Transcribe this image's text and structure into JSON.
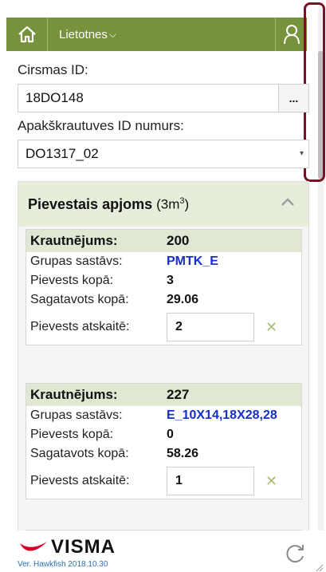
{
  "topbar": {
    "apps_label": "Lietotnes",
    "apps_chevron": "⌵"
  },
  "form": {
    "cirsmas_label": "Cirsmas ID:",
    "cirsmas_value": "18DO148",
    "browse_label": "...",
    "apaks_label": "Apakškrautuves ID numurs:",
    "apaks_value": "DO1317_02"
  },
  "panel": {
    "title": "Pievestais apjoms",
    "unit_prefix": "(3m",
    "unit_sup": "3",
    "unit_suffix": ")"
  },
  "cards": [
    {
      "head_label": "Krautnējums:",
      "head_value": "200",
      "group_label": "Grupas sastāvs:",
      "group_value": "PMTK_E",
      "total_label": "Pievests kopā:",
      "total_value": "3",
      "prepared_label": "Sagatavots kopā:",
      "prepared_value": "29.06",
      "report_label": "Pievests atskaitē:",
      "report_value": "2"
    },
    {
      "head_label": "Krautnējums:",
      "head_value": "227",
      "group_label": "Grupas sastāvs:",
      "group_value": "E_10X14,18X28,28",
      "total_label": "Pievests kopā:",
      "total_value": "0",
      "prepared_label": "Sagatavots kopā:",
      "prepared_value": "58.26",
      "report_label": "Pievests atskaitē:",
      "report_value": "1"
    }
  ],
  "footer": {
    "logo_text": "VISMA",
    "version": "Ver. Hawkfish 2018.10.30"
  },
  "colors": {
    "header_green": "#76923c",
    "panel_header": "#e6eddb",
    "card_head": "#e0e8d4",
    "link_blue": "#1530c8",
    "logo_red": "#d4002d",
    "highlight": "#7a1026"
  },
  "icons": [
    "home-icon",
    "user-icon",
    "chevron-up-icon",
    "close-icon",
    "refresh-icon",
    "visma-logo-icon",
    "resize-grip-icon"
  ]
}
